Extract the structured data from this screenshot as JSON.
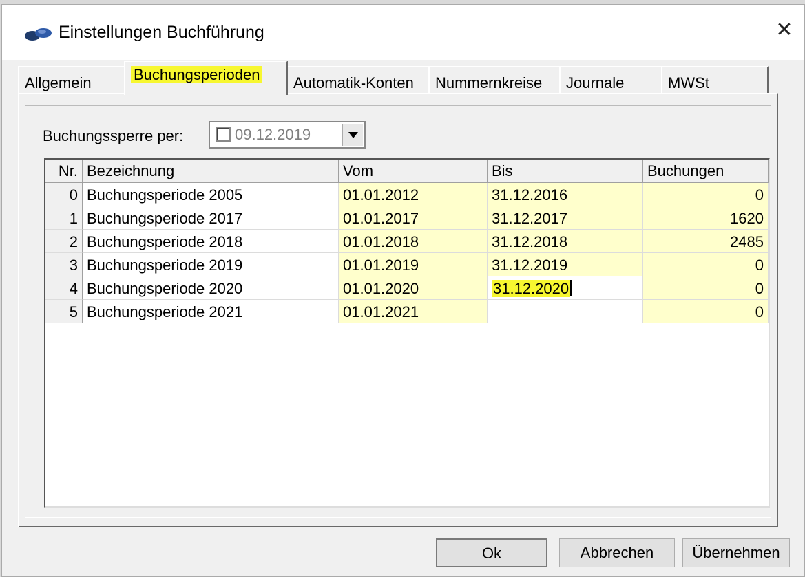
{
  "window": {
    "title": "Einstellungen Buchführung"
  },
  "tabs": [
    {
      "label": "Allgemein"
    },
    {
      "label": "Buchungsperioden"
    },
    {
      "label": "Automatik-Konten"
    },
    {
      "label": "Nummernkreise"
    },
    {
      "label": "Journale"
    },
    {
      "label": "MWSt"
    }
  ],
  "lock": {
    "label": "Buchungssperre per:",
    "date": "09.12.2019",
    "checked": false
  },
  "grid": {
    "headers": [
      "Nr.",
      "Bezeichnung",
      "Vom",
      "Bis",
      "Buchungen"
    ],
    "rows": [
      [
        "0",
        "Buchungsperiode 2005",
        "01.01.2012",
        "31.12.2016",
        "0"
      ],
      [
        "1",
        "Buchungsperiode 2017",
        "01.01.2017",
        "31.12.2017",
        "1620"
      ],
      [
        "2",
        "Buchungsperiode 2018",
        "01.01.2018",
        "31.12.2018",
        "2485"
      ],
      [
        "3",
        "Buchungsperiode 2019",
        "01.01.2019",
        "31.12.2019",
        "0"
      ],
      [
        "4",
        "Buchungsperiode 2020",
        "01.01.2020",
        "31.12.2020",
        "0"
      ],
      [
        "5",
        "Buchungsperiode 2021",
        "01.01.2021",
        "",
        "0"
      ]
    ]
  },
  "buttons": {
    "ok": "Ok",
    "cancel": "Abbrechen",
    "apply": "Übernehmen"
  },
  "colors": {
    "highlight": "#f7f730",
    "editable_cell": "#ffffcc"
  }
}
